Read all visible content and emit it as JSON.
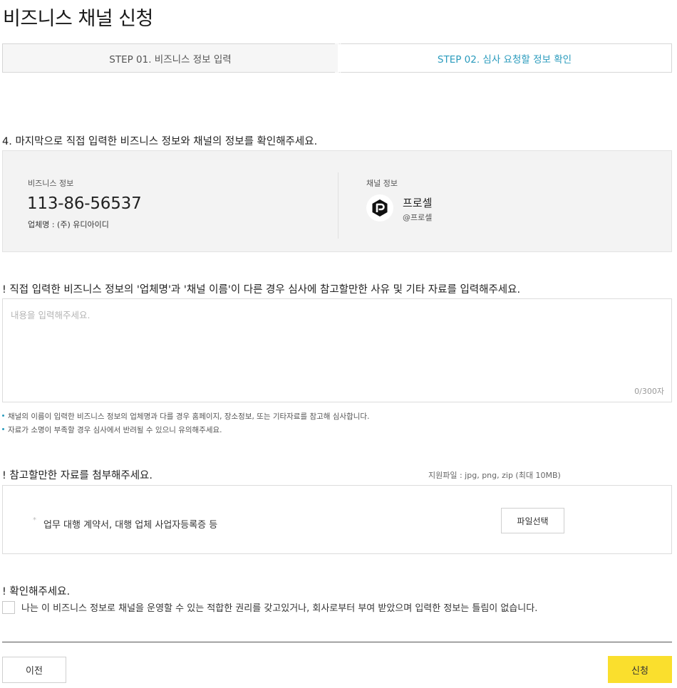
{
  "page": {
    "title": "비즈니스 채널 신청"
  },
  "steps": [
    {
      "label": "STEP 01. 비즈니스 정보 입력",
      "active": false
    },
    {
      "label": "STEP 02. 심사 요청할 정보 확인",
      "active": true
    }
  ],
  "review": {
    "heading": "4. 마지막으로 직접 입력한 비즈니스 정보와 채널의 정보를 확인해주세요.",
    "business": {
      "label": "비즈니스 정보",
      "number": "113-86-56537",
      "company": "업체명 : (주) 유디아이디"
    },
    "channel": {
      "label": "채널 정보",
      "logo_icon": "channel-logo-icon",
      "name": "프로셀",
      "id": "@프로셀"
    }
  },
  "reason": {
    "heading": "! 직접 입력한 비즈니스 정보의 '업체명'과 '채널 이름'이 다른 경우 심사에 참고할만한 사유 및 기타 자료를 입력해주세요.",
    "placeholder": "내용을 입력해주세요.",
    "value": "",
    "counter": "0/300자",
    "notes": [
      "채널의 이름이 입력한 비즈니스 정보의 업체명과 다를 경우 홈페이지, 장소정보, 또는 기타자료를 참고해 심사합니다.",
      "자료가 소명이 부족할 경우 심사에서 반려될 수 있으니 유의해주세요."
    ]
  },
  "attachment": {
    "heading": "! 참고할만한 자료를 첨부해주세요.",
    "supported": "지원파일 : jpg, png, zip (최대 10MB)",
    "bullet": "*",
    "description": "업무 대행 계약서, 대행 업체 사업자등록증 등",
    "button_label": "파일선택"
  },
  "confirm": {
    "heading": "! 확인해주세요.",
    "checkbox_label": "나는 이 비즈니스 정보로 채널을 운영할 수 있는 적합한 권리를 갖고있거나, 회사로부터 부여 받았으며 입력한 정보는 틀림이 없습니다.",
    "checked": false
  },
  "actions": {
    "prev_label": "이전",
    "submit_label": "신청"
  },
  "colors": {
    "accent": "#2a9bbd",
    "submit": "#fadf2d",
    "panel": "#f3f3f3"
  }
}
